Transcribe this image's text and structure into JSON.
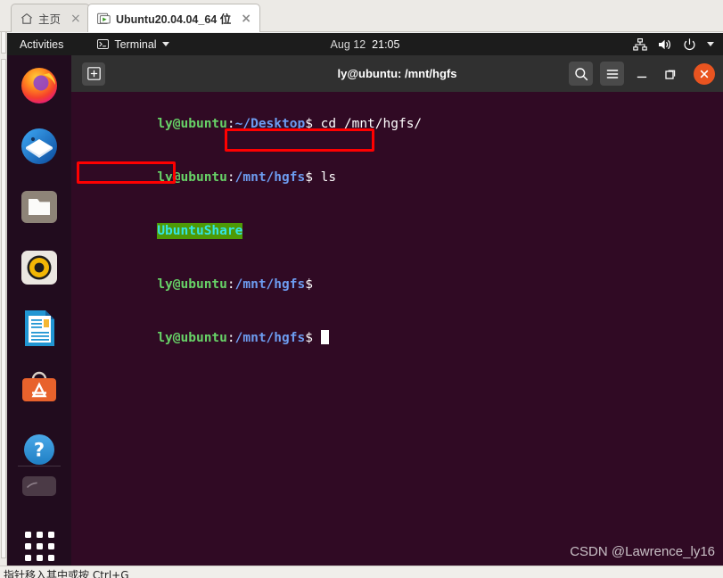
{
  "vmware": {
    "tabs": [
      {
        "label": "主页",
        "icon": "home-icon",
        "close": "×",
        "active": false
      },
      {
        "label": "Ubuntu20.04.04_64 位",
        "icon": "vm-power-icon",
        "close": "×",
        "active": true
      }
    ],
    "statusbar_text": "指针移入其中或按 Ctrl+G"
  },
  "topbar": {
    "activities": "Activities",
    "app_menu": "Terminal",
    "app_menu_icon": "terminal-icon",
    "caret_icon": "chevron-down-icon",
    "clock_date": "Aug 12",
    "clock_time": "21:05",
    "tray": [
      {
        "name": "network-icon"
      },
      {
        "name": "volume-icon"
      },
      {
        "name": "power-icon"
      },
      {
        "name": "chevron-down-icon"
      }
    ]
  },
  "dock": {
    "items": [
      {
        "name": "firefox",
        "label": "Firefox"
      },
      {
        "name": "thunderbird",
        "label": "Thunderbird Mail"
      },
      {
        "name": "files",
        "label": "Files"
      },
      {
        "name": "rhythmbox",
        "label": "Rhythmbox"
      },
      {
        "name": "libreoffice-writer",
        "label": "LibreOffice Writer"
      },
      {
        "name": "ubuntu-software",
        "label": "Ubuntu Software"
      },
      {
        "name": "help",
        "label": "Help"
      }
    ],
    "trash": {
      "name": "trash",
      "label": "Trash"
    },
    "show_apps": {
      "name": "show-applications",
      "label": "Show Applications"
    }
  },
  "terminal": {
    "title": "ly@ubuntu: /mnt/hgfs",
    "new_tab_icon": "new-tab-icon",
    "search_icon": "search-icon",
    "menu_icon": "hamburger-menu-icon",
    "minimize_icon": "minimize-icon",
    "maximize_icon": "maximize-icon",
    "close_icon": "close-icon",
    "lines": [
      {
        "type": "prompt_command",
        "user": "ly@ubuntu",
        "colon": ":",
        "path": "~/Desktop",
        "dollar": "$ ",
        "command": "cd /mnt/hgfs/"
      },
      {
        "type": "prompt_command",
        "user": "ly@ubuntu",
        "colon": ":",
        "path": "/mnt/hgfs",
        "dollar": "$ ",
        "command": "ls"
      },
      {
        "type": "output_dir",
        "text": "UbuntuShare"
      },
      {
        "type": "prompt",
        "user": "ly@ubuntu",
        "colon": ":",
        "path": "/mnt/hgfs",
        "dollar": "$",
        "command": ""
      },
      {
        "type": "prompt_cursor",
        "user": "ly@ubuntu",
        "colon": ":",
        "path": "/mnt/hgfs",
        "dollar": "$ ",
        "command": ""
      }
    ]
  },
  "annotations": {
    "command_box": "cd /mnt/hgfs/",
    "directory_box": "UbuntuShare"
  },
  "watermark": "CSDN @Lawrence_ly16",
  "colors": {
    "terminal_bg": "#300a24",
    "header_bg": "#303030",
    "topbar_bg": "#1c1c1c",
    "accent_orange": "#e95420",
    "annotation_red": "#ff0000",
    "highlight_green": "#4e9a06",
    "prompt_green": "#67d267",
    "prompt_blue": "#6d9cf0"
  }
}
